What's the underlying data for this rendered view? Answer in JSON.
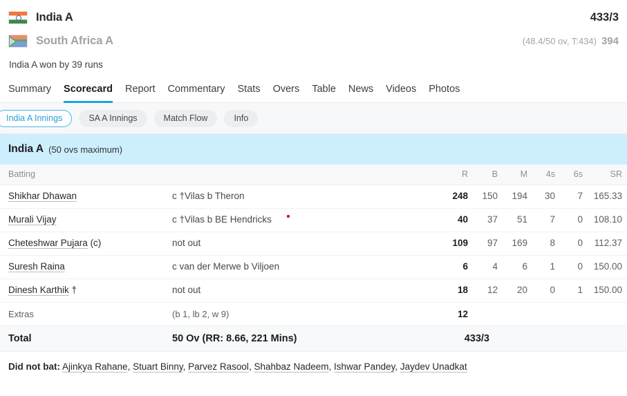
{
  "header": {
    "teams": [
      {
        "name": "India A",
        "flag": "india-flag-icon",
        "score": "433/3",
        "meta": ""
      },
      {
        "name": "South Africa A",
        "flag": "south-africa-flag-icon",
        "score": "394",
        "meta": "(48.4/50 ov, T:434)"
      }
    ],
    "result": "India A won by 39 runs"
  },
  "nav": {
    "tabs": [
      {
        "label": "Summary",
        "active": false
      },
      {
        "label": "Scorecard",
        "active": true
      },
      {
        "label": "Report",
        "active": false
      },
      {
        "label": "Commentary",
        "active": false
      },
      {
        "label": "Stats",
        "active": false
      },
      {
        "label": "Overs",
        "active": false
      },
      {
        "label": "Table",
        "active": false
      },
      {
        "label": "News",
        "active": false
      },
      {
        "label": "Videos",
        "active": false
      },
      {
        "label": "Photos",
        "active": false
      }
    ]
  },
  "pills": [
    {
      "label": "India A Innings",
      "active": true
    },
    {
      "label": "SA A Innings",
      "active": false
    },
    {
      "label": "Match Flow",
      "active": false
    },
    {
      "label": "Info",
      "active": false
    }
  ],
  "innings": {
    "team": "India A",
    "overs_note": "(50 ovs maximum)",
    "columns": {
      "batting": "Batting",
      "r": "R",
      "b": "B",
      "m": "M",
      "fours": "4s",
      "sixes": "6s",
      "sr": "SR"
    },
    "batsmen": [
      {
        "name": "Shikhar Dhawan",
        "suffix": "",
        "dismissal": "c †Vilas b Theron",
        "marker": false,
        "r": "248",
        "b": "150",
        "m": "194",
        "fours": "30",
        "sixes": "7",
        "sr": "165.33"
      },
      {
        "name": "Murali Vijay",
        "suffix": "",
        "dismissal": "c †Vilas b BE Hendricks",
        "marker": true,
        "r": "40",
        "b": "37",
        "m": "51",
        "fours": "7",
        "sixes": "0",
        "sr": "108.10"
      },
      {
        "name": "Cheteshwar Pujara",
        "suffix": " (c)",
        "dismissal": "not out",
        "marker": false,
        "r": "109",
        "b": "97",
        "m": "169",
        "fours": "8",
        "sixes": "0",
        "sr": "112.37"
      },
      {
        "name": "Suresh Raina",
        "suffix": "",
        "dismissal": "c van der Merwe b Viljoen",
        "marker": false,
        "r": "6",
        "b": "4",
        "m": "6",
        "fours": "1",
        "sixes": "0",
        "sr": "150.00"
      },
      {
        "name": "Dinesh Karthik",
        "suffix": " †",
        "dismissal": "not out",
        "marker": false,
        "r": "18",
        "b": "12",
        "m": "20",
        "fours": "0",
        "sixes": "1",
        "sr": "150.00"
      }
    ],
    "extras": {
      "label": "Extras",
      "detail": "(b 1, lb 2, w 9)",
      "value": "12"
    },
    "total": {
      "label": "Total",
      "detail": "50 Ov (RR: 8.66, 221 Mins)",
      "value": "433/3"
    },
    "did_not_bat": {
      "label": "Did not bat:",
      "players": [
        "Ajinkya Rahane",
        "Stuart Binny",
        "Parvez Rasool",
        "Shahbaz Nadeem",
        "Ishwar Pandey",
        "Jaydev Unadkat"
      ]
    }
  },
  "colors": {
    "accent": "#1ca2e0",
    "banner": "#cdeefc",
    "marker": "#c0232c"
  }
}
